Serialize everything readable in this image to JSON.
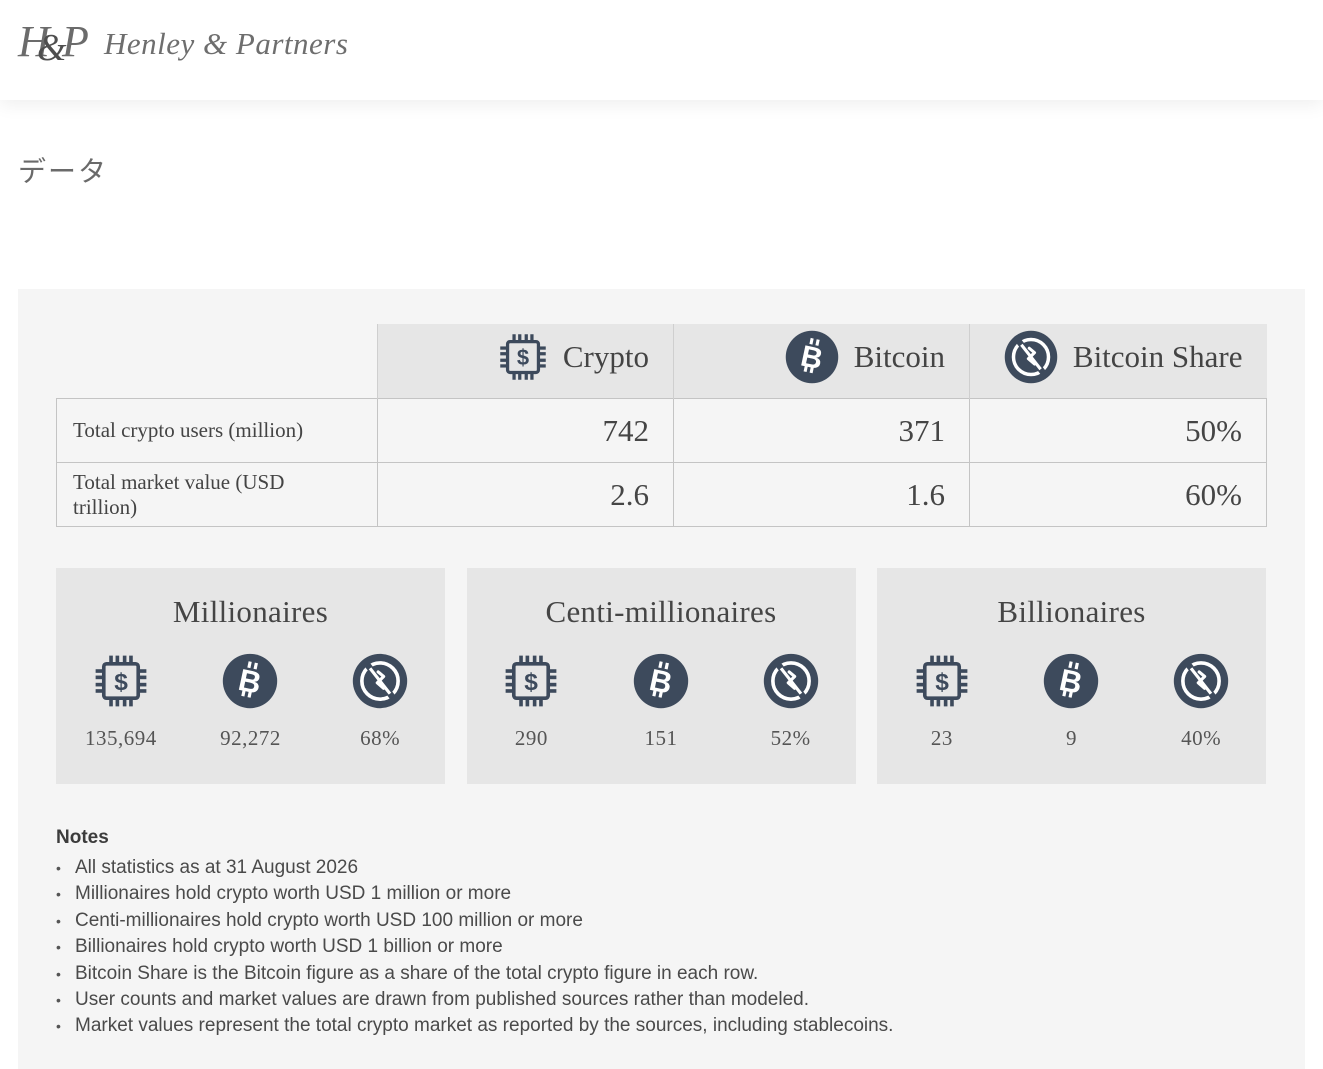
{
  "header": {
    "logo_mark": "H&P",
    "brand": "Henley & Partners"
  },
  "page": {
    "title": "データ"
  },
  "table": {
    "columns": [
      {
        "label": "Crypto",
        "icon": "chip-dollar-icon"
      },
      {
        "label": "Bitcoin",
        "icon": "bitcoin-icon"
      },
      {
        "label": "Bitcoin Share",
        "icon": "share-icon"
      }
    ],
    "rows": [
      {
        "label": "Total crypto users (million)",
        "values": [
          "742",
          "371",
          "50%"
        ]
      },
      {
        "label": "Total market value (USD trillion)",
        "values": [
          "2.6",
          "1.6",
          "60%"
        ]
      }
    ]
  },
  "cards": [
    {
      "title": "Millionaires",
      "values": [
        "135,694",
        "92,272",
        "68%"
      ]
    },
    {
      "title": "Centi-millionaires",
      "values": [
        "290",
        "151",
        "52%"
      ]
    },
    {
      "title": "Billionaires",
      "values": [
        "23",
        "9",
        "40%"
      ]
    }
  ],
  "notes": {
    "title": "Notes",
    "items": [
      "All statistics as at 31 August 2026",
      "Millionaires hold crypto worth USD 1 million or more",
      "Centi-millionaires hold crypto worth USD 100 million or more",
      "Billionaires hold crypto worth USD 1 billion or more",
      "Bitcoin Share is the Bitcoin figure as a share of the total crypto figure in each row.",
      "User counts and market values are drawn from published sources rather than modeled.",
      "Market values represent the total crypto market as reported by the sources, including stablecoins."
    ]
  },
  "colors": {
    "icon": "#3d4a5c",
    "panel": "#f5f5f5",
    "header_cell": "#e6e6e6"
  }
}
